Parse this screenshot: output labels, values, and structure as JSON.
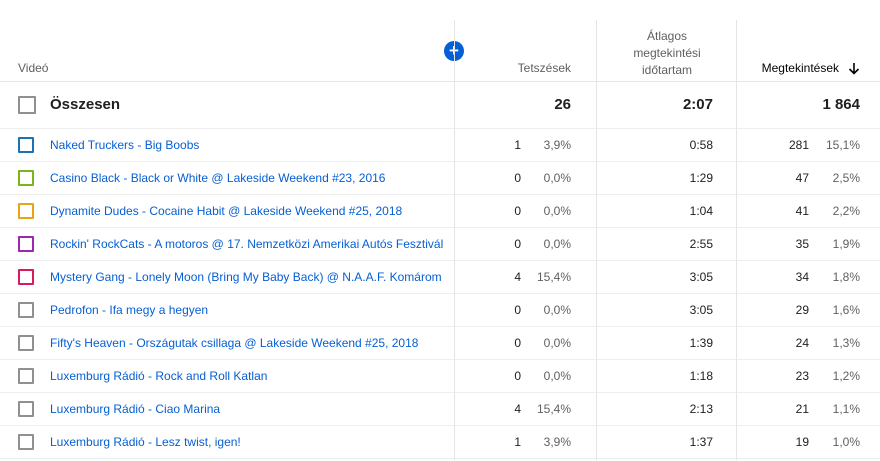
{
  "header": {
    "video_label": "Videó",
    "likes_label": "Tetszések",
    "avg_line1": "Átlagos",
    "avg_line2": "megtekintési",
    "avg_line3": "időtartam",
    "views_label": "Megtekintések",
    "add_icon": "plus-circle-icon",
    "sort_icon": "arrow-down-icon"
  },
  "total": {
    "label": "Összesen",
    "likes": "26",
    "avg": "2:07",
    "views": "1 864"
  },
  "rows": [
    {
      "title": "Naked Truckers - Big Boobs",
      "likes": "1",
      "likes_pct": "3,9%",
      "avg": "0:58",
      "views": "281",
      "views_pct": "15,1%",
      "color": "#1a73b5"
    },
    {
      "title": "Casino Black - Black or White @ Lakeside Weekend #23, 2016",
      "likes": "0",
      "likes_pct": "0,0%",
      "avg": "1:29",
      "views": "47",
      "views_pct": "2,5%",
      "color": "#7cb518"
    },
    {
      "title": "Dynamite Dudes - Cocaine Habit @ Lakeside Weekend #25, 2018",
      "likes": "0",
      "likes_pct": "0,0%",
      "avg": "1:04",
      "views": "41",
      "views_pct": "2,2%",
      "color": "#e8a317"
    },
    {
      "title": "Rockin' RockCats - A motoros @ 17. Nemzetközi Amerikai Autós Fesztivál",
      "likes": "0",
      "likes_pct": "0,0%",
      "avg": "2:55",
      "views": "35",
      "views_pct": "1,9%",
      "color": "#9c27b0"
    },
    {
      "title": "Mystery Gang - Lonely Moon (Bring My Baby Back) @ N.A.A.F. Komárom",
      "likes": "4",
      "likes_pct": "15,4%",
      "avg": "3:05",
      "views": "34",
      "views_pct": "1,8%",
      "color": "#d81b60"
    },
    {
      "title": "Pedrofon - Ifa megy a hegyen",
      "likes": "0",
      "likes_pct": "0,0%",
      "avg": "3:05",
      "views": "29",
      "views_pct": "1,6%",
      "color": "#909090"
    },
    {
      "title": "Fifty's Heaven - Országutak csillaga @ Lakeside Weekend #25, 2018",
      "likes": "0",
      "likes_pct": "0,0%",
      "avg": "1:39",
      "views": "24",
      "views_pct": "1,3%",
      "color": "#909090"
    },
    {
      "title": "Luxemburg Rádió - Rock and Roll Katlan",
      "likes": "0",
      "likes_pct": "0,0%",
      "avg": "1:18",
      "views": "23",
      "views_pct": "1,2%",
      "color": "#909090"
    },
    {
      "title": "Luxemburg Rádió - Ciao Marina",
      "likes": "4",
      "likes_pct": "15,4%",
      "avg": "2:13",
      "views": "21",
      "views_pct": "1,1%",
      "color": "#909090"
    },
    {
      "title": "Luxemburg Rádió - Lesz twist, igen!",
      "likes": "1",
      "likes_pct": "3,9%",
      "avg": "1:37",
      "views": "19",
      "views_pct": "1,0%",
      "color": "#909090"
    }
  ]
}
